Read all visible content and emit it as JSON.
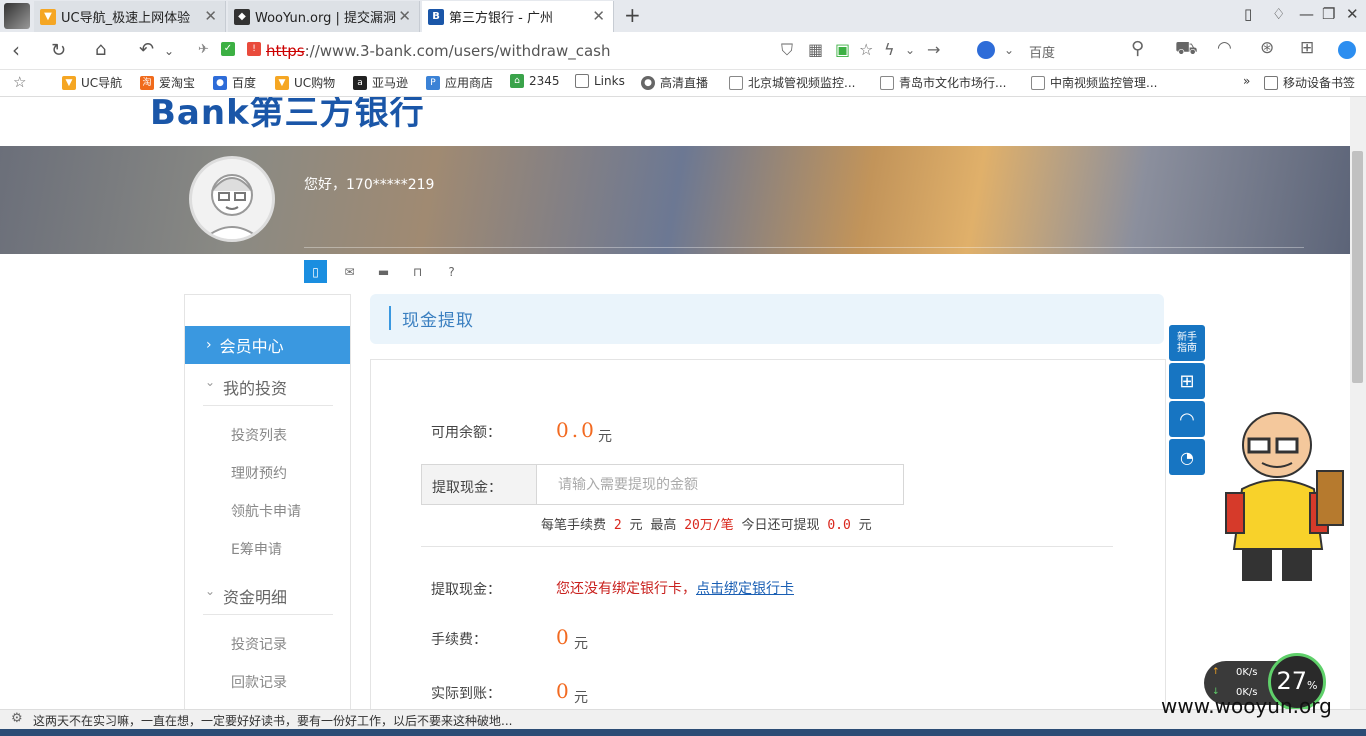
{
  "tabs": [
    {
      "title": "UC导航_极速上网体验",
      "icon_color": "#f5a623"
    },
    {
      "title": "WooYun.org | 提交漏洞",
      "icon_color": "#333333"
    },
    {
      "title": "第三方银行 - 广州",
      "icon_color": "#1a56a8"
    }
  ],
  "address": {
    "protocol": "https",
    "rest": "://www.3-bank.com/users/withdraw_cash",
    "search_engine": "百度"
  },
  "bookmarks": [
    "UC导航",
    "爱淘宝",
    "百度",
    "UC购物",
    "亚马逊",
    "应用商店",
    "2345",
    "Links",
    "高清直播",
    "北京城管视频监控...",
    "青岛市文化市场行...",
    "中南视频监控管理...",
    "移动设备书签"
  ],
  "bookmarks_more": "»",
  "site": {
    "logo": "Bank第三方银行",
    "greeting": "您好，170*****219"
  },
  "sidebar": {
    "active": "会员中心",
    "groups": [
      {
        "label": "我的投资",
        "items": [
          "投资列表",
          "理财预约",
          "领航卡申请",
          "E筹申请"
        ]
      },
      {
        "label": "资金明细",
        "items": [
          "投资记录",
          "回款记录"
        ]
      }
    ]
  },
  "main": {
    "title": "现金提取",
    "available_label": "可用余额：",
    "available_value": "0.0",
    "unit": "元",
    "input_label": "提取现金：",
    "input_placeholder": "请输入需要提现的金额",
    "fee_prefix": "每笔手续费",
    "fee_value": "2",
    "fee_unit": "元",
    "max_prefix": "最高",
    "max_value": "20万/笔",
    "today_prefix": "今日还可提现",
    "today_value": "0.0",
    "withdraw_label": "提取现金：",
    "no_card_text": "您还没有绑定银行卡，",
    "bind_link": "点击绑定银行卡",
    "fee_label": "手续费：",
    "fee_amount": "0",
    "actual_label": "实际到账：",
    "actual_amount": "0"
  },
  "float_tools": [
    "新手指南"
  ],
  "speed": {
    "up": "0K/s",
    "down": "0K/s",
    "percent": "27",
    "percent_sign": "%"
  },
  "status_text": "这两天不在实习嘛，一直在想，一定要好好读书，要有一份好工作，以后不要来这种破地...",
  "watermark": "www.wooyun.org",
  "colors": {
    "accent": "#3a98e0",
    "orange": "#f26a21",
    "red": "#c9211e"
  }
}
